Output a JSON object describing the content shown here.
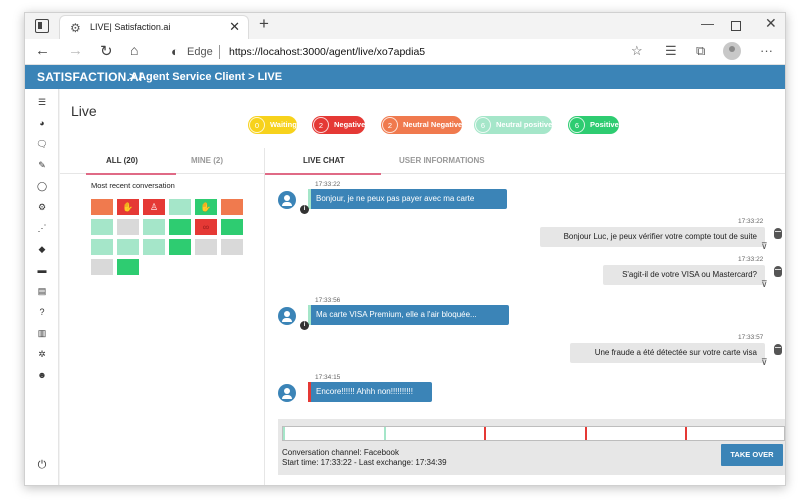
{
  "browser": {
    "tab_title": "LIVE| Satisfaction.ai",
    "tab_close": "✕",
    "new_tab": "+",
    "edge_label": "Edge",
    "url": "https://locahost:3000/agent/live/xo7apdia5",
    "min": "—",
    "close": "✕"
  },
  "header": {
    "brand": "SATISFACTION.AI",
    "breadcrumb": "> Agent Service Client > LIVE"
  },
  "page": {
    "title": "Live"
  },
  "legend": [
    {
      "count": "0",
      "label": "Waiting",
      "color": "#f7d21c"
    },
    {
      "count": "2",
      "label": "Negative",
      "color": "#e53935"
    },
    {
      "count": "2",
      "label": "Neutral Negative",
      "color": "#f07a4e"
    },
    {
      "count": "6",
      "label": "Neutral positive",
      "color": "#a5e6c9"
    },
    {
      "count": "6",
      "label": "Positive",
      "color": "#2ecc71"
    }
  ],
  "conversations": {
    "tab_all": "ALL (20)",
    "tab_mine": "MINE (2)",
    "recent_label": "Most recent conversation"
  },
  "chat": {
    "tab_live": "LIVE CHAT",
    "tab_user": "USER INFORMATIONS",
    "messages": [
      {
        "time": "17:33:22",
        "text": "Bonjour, je ne peux pas payer avec ma carte"
      },
      {
        "time": "17:33:22",
        "text": "Bonjour Luc, je peux vérifier votre compte tout de suite"
      },
      {
        "time": "17:33:22",
        "text": "S'agit-il de votre VISA ou Mastercard?"
      },
      {
        "time": "17:33:56",
        "text": "Ma carte VISA Premium, elle a l'air bloquée..."
      },
      {
        "time": "17:33:57",
        "text": "Une fraude a été détectée sur votre carte visa"
      },
      {
        "time": "17:34:15",
        "text": "Encore!!!!!! Ahhh non!!!!!!!!!!"
      }
    ]
  },
  "status": {
    "channel": "Conversation channel: Facebook",
    "times": "Start time: 17:33:22 - Last exchange: 17:34:39",
    "take_over": "TAKE OVER"
  },
  "colors": {
    "accent": "#3b84b7",
    "tab_underline": "#e06a86"
  }
}
